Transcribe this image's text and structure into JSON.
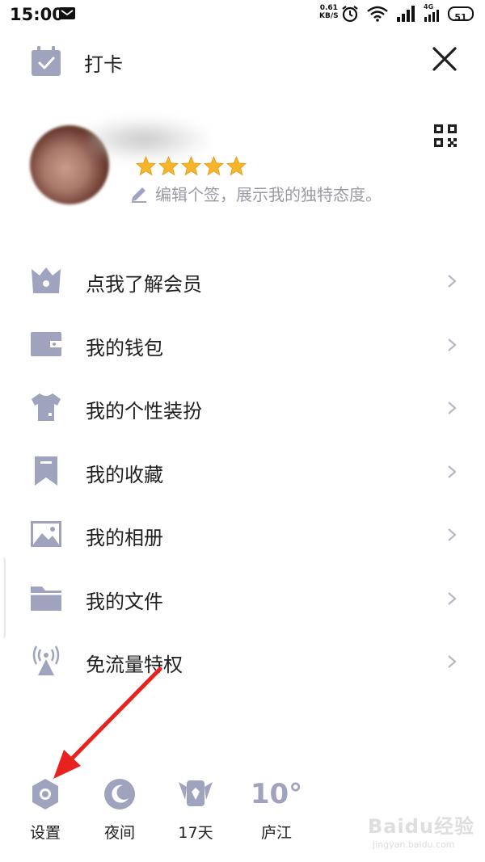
{
  "status_bar": {
    "time": "15:00",
    "speed_value": "0.61",
    "speed_unit": "KB/S",
    "network": "4G",
    "battery": "51"
  },
  "header": {
    "checkin_label": "打卡"
  },
  "profile": {
    "stars_count": 5,
    "signature_placeholder": "编辑个签，展示我的独特态度。"
  },
  "menu": {
    "items": [
      {
        "label": "点我了解会员",
        "icon": "vip-crown-icon"
      },
      {
        "label": "我的钱包",
        "icon": "wallet-icon"
      },
      {
        "label": "我的个性装扮",
        "icon": "shirt-icon"
      },
      {
        "label": "我的收藏",
        "icon": "bookmark-icon"
      },
      {
        "label": "我的相册",
        "icon": "photo-album-icon"
      },
      {
        "label": "我的文件",
        "icon": "folder-icon"
      },
      {
        "label": "免流量特权",
        "icon": "signal-tower-icon"
      }
    ]
  },
  "bottom_bar": {
    "settings_label": "设置",
    "night_label": "夜间",
    "streak_label": "17天",
    "weather_temp": "10°",
    "weather_city": "庐江"
  },
  "watermark": {
    "brand": "Baidu经验",
    "url": "jingyan.baidu.com"
  },
  "colors": {
    "icon_gray": "#a0a3bd",
    "text": "#1f1f1f",
    "secondary_text": "#9a9aa6",
    "star_gold": "#f7b52c",
    "annotation_red": "#e8231f"
  }
}
